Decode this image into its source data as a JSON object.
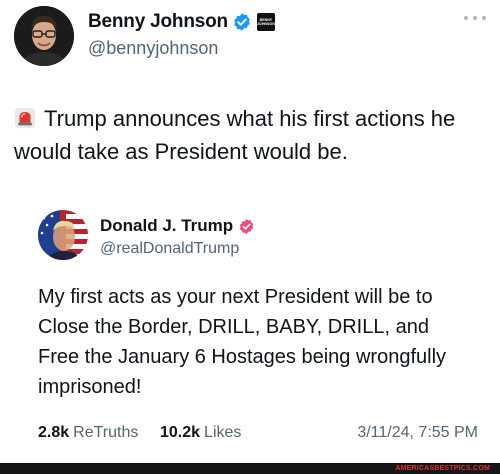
{
  "tweet": {
    "author_name": "Benny Johnson",
    "author_handle": "@bennyjohnson",
    "org_badge_text": "BENNY JOHNSON",
    "text": "Trump announces what his first actions he would take as President would be.",
    "siren_icon": "police-light-emoji"
  },
  "quoted_post": {
    "author_name": "Donald J. Trump",
    "author_handle": "@realDonaldTrump",
    "text": "My first acts as your next President will be to Close the Border, DRILL, BABY, DRILL, and Free the January 6 Hostages being wrongfully imprisoned!",
    "stats": {
      "retruths_count": "2.8k",
      "retruths_label": "ReTruths",
      "likes_count": "10.2k",
      "likes_label": "Likes"
    },
    "timestamp": "3/11/24, 7:55 PM"
  },
  "watermark": "AMERICASBESTPICS.COM",
  "colors": {
    "text_primary": "#0f1419",
    "text_secondary": "#536471",
    "x_verified_blue": "#1d9bf0",
    "truth_verified_pink": "#ea4c7c",
    "siren_red": "#e0342b",
    "watermark_bar": "#17171a"
  }
}
